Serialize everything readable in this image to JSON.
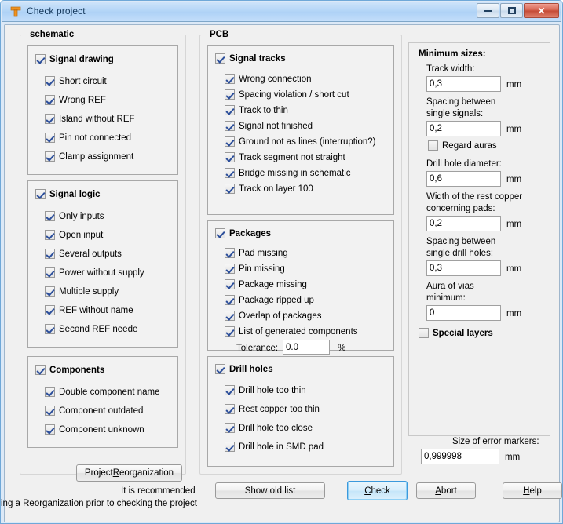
{
  "window": {
    "title": "Check project",
    "icon": "app-t-icon",
    "buttons": {
      "minimize": "minimize",
      "maximize": "maximize",
      "close": "close"
    }
  },
  "schematic": {
    "legend": "schematic",
    "groups": [
      {
        "header": "Signal drawing",
        "header_checked": true,
        "items": [
          {
            "label": "Short circuit",
            "checked": true
          },
          {
            "label": "Wrong REF",
            "checked": true
          },
          {
            "label": "Island without REF",
            "checked": true
          },
          {
            "label": "Pin not connected",
            "checked": true
          },
          {
            "label": "Clamp assignment",
            "checked": true
          }
        ]
      },
      {
        "header": "Signal logic",
        "header_checked": true,
        "items": [
          {
            "label": "Only inputs",
            "checked": true
          },
          {
            "label": "Open input",
            "checked": true
          },
          {
            "label": "Several outputs",
            "checked": true
          },
          {
            "label": "Power without supply",
            "checked": true
          },
          {
            "label": "Multiple supply",
            "checked": true
          },
          {
            "label": "REF without name",
            "checked": true
          },
          {
            "label": "Second REF neede",
            "checked": true
          }
        ]
      },
      {
        "header": "Components",
        "header_checked": true,
        "items": [
          {
            "label": "Double component name",
            "checked": true
          },
          {
            "label": "Component outdated",
            "checked": true
          },
          {
            "label": "Component unknown",
            "checked": true
          }
        ]
      }
    ],
    "reorganization_button": "ProjectReorganization",
    "reorganization_button_accesskey": "R",
    "hint_line1": "It is recommended",
    "hint_line2": "ing a Reorganization prior to checking the project"
  },
  "pcb": {
    "legend": "PCB",
    "groups": [
      {
        "header": "Signal tracks",
        "header_checked": true,
        "items": [
          {
            "label": "Wrong connection",
            "checked": true
          },
          {
            "label": "Spacing violation / short cut",
            "checked": true
          },
          {
            "label": "Track to thin",
            "checked": true
          },
          {
            "label": "Signal not finished",
            "checked": true
          },
          {
            "label": "Ground not as lines (interruption?)",
            "checked": true
          },
          {
            "label": "Track segment not straight",
            "checked": true
          },
          {
            "label": "Bridge missing in schematic",
            "checked": true
          },
          {
            "label": "Track on layer 100",
            "checked": true
          }
        ]
      },
      {
        "header": "Packages",
        "header_checked": true,
        "items": [
          {
            "label": "Pad missing",
            "checked": true
          },
          {
            "label": "Pin missing",
            "checked": true
          },
          {
            "label": "Package missing",
            "checked": true
          },
          {
            "label": "Package ripped up",
            "checked": true
          },
          {
            "label": "Overlap of packages",
            "checked": true
          },
          {
            "label": "List of generated components",
            "checked": true
          }
        ],
        "tolerance": {
          "label": "Tolerance:",
          "value": "0.0",
          "unit": "%"
        }
      },
      {
        "header": "Drill holes",
        "header_checked": true,
        "items": [
          {
            "label": "Drill hole too thin",
            "checked": true
          },
          {
            "label": "Rest copper too thin",
            "checked": true
          },
          {
            "label": "Drill hole too close",
            "checked": true
          },
          {
            "label": "Drill hole in SMD pad",
            "checked": true
          }
        ]
      }
    ]
  },
  "minimum_sizes": {
    "title": "Minimum sizes:",
    "fields": [
      {
        "label": "Track width:",
        "value": "0,3",
        "unit": "mm"
      },
      {
        "label_line1": "Spacing between",
        "label_line2": "single signals:",
        "value": "0,2",
        "unit": "mm"
      },
      {
        "label": "Drill hole diameter:",
        "value": "0,6",
        "unit": "mm"
      },
      {
        "label_line1": "Width of the rest copper",
        "label_line2": "concerning pads:",
        "value": "0,2",
        "unit": "mm"
      },
      {
        "label_line1": "Spacing between",
        "label_line2": "single drill holes:",
        "value": "0,3",
        "unit": "mm"
      },
      {
        "label_line1": "Aura of vias",
        "label_line2": "minimum:",
        "value": "0",
        "unit": "mm"
      }
    ],
    "regard_auras": {
      "label": "Regard auras",
      "checked": false
    },
    "special_layers": {
      "label": "Special layers",
      "checked": false
    }
  },
  "error_markers": {
    "label": "Size of error markers:",
    "value": "0,999998",
    "unit": "mm"
  },
  "footer": {
    "show_old_list": "Show old list",
    "check": "Check",
    "check_accesskey": "C",
    "abort": "Abort",
    "abort_accesskey": "A",
    "help": "Help",
    "help_accesskey": "H"
  },
  "colors": {
    "titlebar": "#b3d4f5",
    "dialog": "#f0f0f0",
    "panel": "#f2f2f2",
    "check": "#2b4e9b",
    "focus": "#3c99dc",
    "close": "#c44a36"
  }
}
